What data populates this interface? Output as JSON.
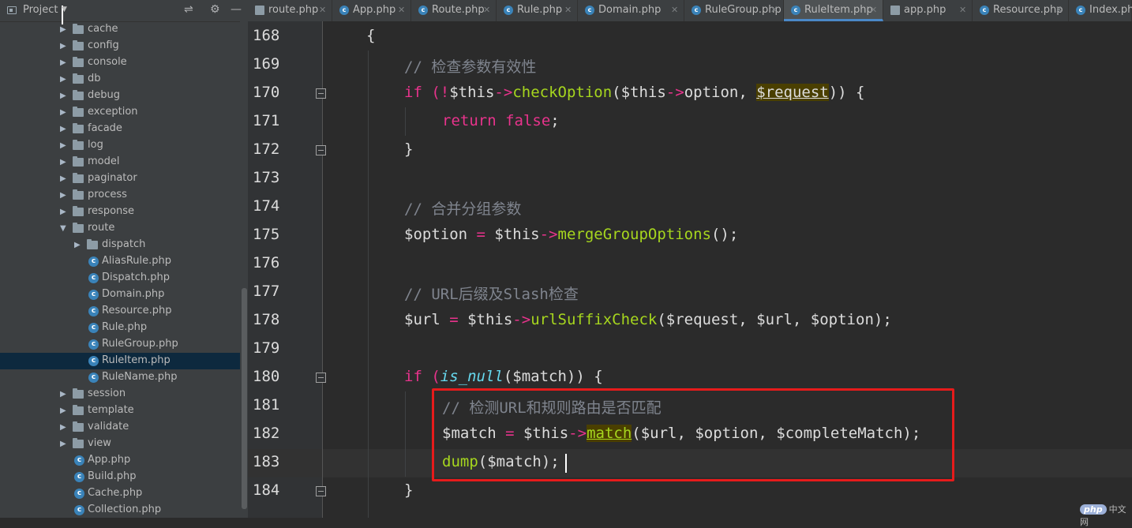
{
  "sidebar": {
    "title": "Project",
    "items": [
      {
        "label": "cache",
        "type": "folder",
        "depth": 0,
        "expanded": false
      },
      {
        "label": "config",
        "type": "folder",
        "depth": 0,
        "expanded": false
      },
      {
        "label": "console",
        "type": "folder",
        "depth": 0,
        "expanded": false
      },
      {
        "label": "db",
        "type": "folder",
        "depth": 0,
        "expanded": false
      },
      {
        "label": "debug",
        "type": "folder",
        "depth": 0,
        "expanded": false
      },
      {
        "label": "exception",
        "type": "folder",
        "depth": 0,
        "expanded": false
      },
      {
        "label": "facade",
        "type": "folder",
        "depth": 0,
        "expanded": false
      },
      {
        "label": "log",
        "type": "folder",
        "depth": 0,
        "expanded": false
      },
      {
        "label": "model",
        "type": "folder",
        "depth": 0,
        "expanded": false
      },
      {
        "label": "paginator",
        "type": "folder",
        "depth": 0,
        "expanded": false
      },
      {
        "label": "process",
        "type": "folder",
        "depth": 0,
        "expanded": false
      },
      {
        "label": "response",
        "type": "folder",
        "depth": 0,
        "expanded": false
      },
      {
        "label": "route",
        "type": "folder",
        "depth": 0,
        "expanded": true
      },
      {
        "label": "dispatch",
        "type": "folder",
        "depth": 1,
        "expanded": false
      },
      {
        "label": "AliasRule.php",
        "type": "class",
        "depth": 1
      },
      {
        "label": "Dispatch.php",
        "type": "class",
        "depth": 1
      },
      {
        "label": "Domain.php",
        "type": "class",
        "depth": 1
      },
      {
        "label": "Resource.php",
        "type": "class",
        "depth": 1
      },
      {
        "label": "Rule.php",
        "type": "class",
        "depth": 1
      },
      {
        "label": "RuleGroup.php",
        "type": "class",
        "depth": 1
      },
      {
        "label": "RuleItem.php",
        "type": "class",
        "depth": 1,
        "selected": true
      },
      {
        "label": "RuleName.php",
        "type": "class",
        "depth": 1
      },
      {
        "label": "session",
        "type": "folder",
        "depth": 0,
        "expanded": false
      },
      {
        "label": "template",
        "type": "folder",
        "depth": 0,
        "expanded": false
      },
      {
        "label": "validate",
        "type": "folder",
        "depth": 0,
        "expanded": false
      },
      {
        "label": "view",
        "type": "folder",
        "depth": 0,
        "expanded": false
      },
      {
        "label": "App.php",
        "type": "class",
        "depth": 0
      },
      {
        "label": "Build.php",
        "type": "class",
        "depth": 0
      },
      {
        "label": "Cache.php",
        "type": "class",
        "depth": 0
      },
      {
        "label": "Collection.php",
        "type": "class",
        "depth": 0
      }
    ]
  },
  "tabs": [
    {
      "label": "route.php",
      "icon": "file"
    },
    {
      "label": "App.php",
      "icon": "class"
    },
    {
      "label": "Route.php",
      "icon": "class"
    },
    {
      "label": "Rule.php",
      "icon": "class"
    },
    {
      "label": "Domain.php",
      "icon": "class"
    },
    {
      "label": "RuleGroup.php",
      "icon": "class"
    },
    {
      "label": "RuleItem.php",
      "icon": "class",
      "active": true
    },
    {
      "label": "app.php",
      "icon": "file"
    },
    {
      "label": "Resource.php",
      "icon": "class"
    },
    {
      "label": "Index.php",
      "icon": "class"
    }
  ],
  "editor": {
    "lines": [
      "168",
      "169",
      "170",
      "171",
      "172",
      "173",
      "174",
      "175",
      "176",
      "177",
      "178",
      "179",
      "180",
      "181",
      "182",
      "183",
      "184"
    ],
    "code": {
      "l168": "{",
      "l169": "// 检查参数有效性",
      "l170": [
        "if (",
        "!",
        "$this",
        "->",
        "checkOption",
        "($this",
        "->",
        "option, ",
        "$request",
        ")) {"
      ],
      "l171": [
        "return false",
        ";"
      ],
      "l172": "}",
      "l174": "// 合并分组参数",
      "l175": [
        "$option ",
        "=",
        " $this",
        "->",
        "mergeGroupOptions",
        "();"
      ],
      "l177": "// URL后缀及Slash检查",
      "l178": [
        "$url ",
        "=",
        " $this",
        "->",
        "urlSuffixCheck",
        "($request, $url, $option);"
      ],
      "l180": [
        "if (",
        "is_null",
        "($match)) {"
      ],
      "l181": "// 检测URL和规则路由是否匹配",
      "l182": [
        "$match ",
        "=",
        " $this",
        "->",
        "match",
        "($url, $option, $completeMatch);"
      ],
      "l183": [
        "dump",
        "($match);"
      ],
      "l184": "}"
    }
  },
  "watermark": {
    "badge": "php",
    "text": "中文网"
  },
  "colors": {
    "keyword": "#e8338c",
    "function": "#a6d61e",
    "comment": "#7f848e",
    "highlight_box": "#e61b1b",
    "selection": "#0d293e",
    "tab_underline": "#4a88c7"
  }
}
